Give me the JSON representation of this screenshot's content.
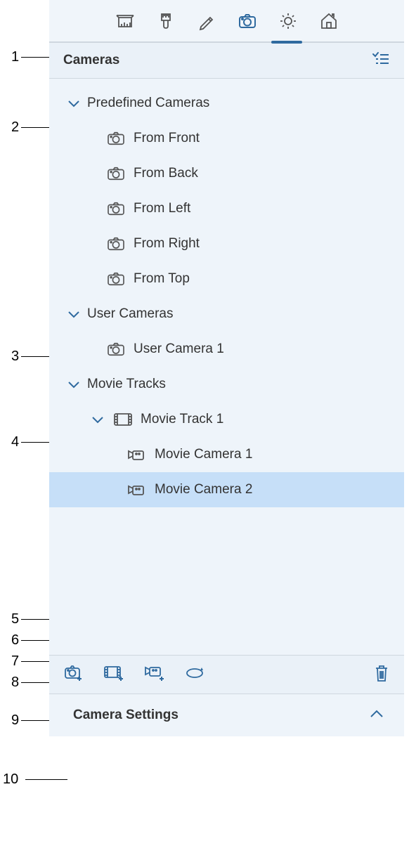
{
  "toolbar": {
    "active_tab_index": 3
  },
  "header": {
    "title": "Cameras"
  },
  "tree": {
    "predefined": {
      "label": "Predefined Cameras",
      "items": [
        {
          "label": "From Front"
        },
        {
          "label": "From Back"
        },
        {
          "label": "From Left"
        },
        {
          "label": "From Right"
        },
        {
          "label": "From Top"
        }
      ]
    },
    "user": {
      "label": "User Cameras",
      "items": [
        {
          "label": "User Camera 1"
        }
      ]
    },
    "movie": {
      "label": "Movie Tracks",
      "tracks": [
        {
          "label": "Movie Track 1",
          "cameras": [
            {
              "label": "Movie Camera 1",
              "selected": false
            },
            {
              "label": "Movie Camera 2",
              "selected": true
            }
          ]
        }
      ]
    }
  },
  "settings": {
    "title": "Camera Settings"
  },
  "callouts": {
    "1": "1",
    "2": "2",
    "3": "3",
    "4": "4",
    "5": "5",
    "6": "6",
    "7": "7",
    "8": "8",
    "9": "9",
    "10": "10"
  }
}
